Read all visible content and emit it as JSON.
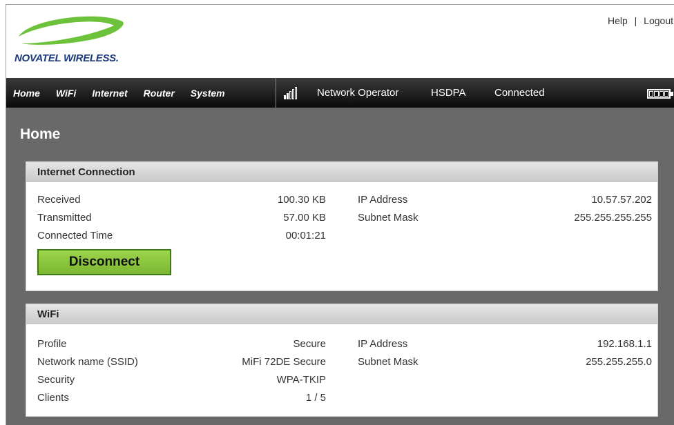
{
  "brand": {
    "name": "NOVATEL WIRELESS."
  },
  "top_links": {
    "help": "Help",
    "separator": "|",
    "logout": "Logout"
  },
  "nav": {
    "items": [
      "Home",
      "WiFi",
      "Internet",
      "Router",
      "System"
    ]
  },
  "status": {
    "signal_bars_filled": 2,
    "signal_bars_total": 5,
    "operator": "Network Operator",
    "technology": "HSDPA",
    "connection": "Connected",
    "battery_cells": 4
  },
  "page": {
    "title": "Home"
  },
  "internet_connection": {
    "title": "Internet Connection",
    "left": [
      {
        "label": "Received",
        "value": "100.30 KB"
      },
      {
        "label": "Transmitted",
        "value": "57.00 KB"
      },
      {
        "label": "Connected Time",
        "value": "00:01:21"
      }
    ],
    "right": [
      {
        "label": "IP Address",
        "value": "10.57.57.202"
      },
      {
        "label": "Subnet Mask",
        "value": "255.255.255.255"
      }
    ],
    "button_label": "Disconnect"
  },
  "wifi": {
    "title": "WiFi",
    "left": [
      {
        "label": "Profile",
        "value": "Secure"
      },
      {
        "label": "Network name (SSID)",
        "value": "MiFi 72DE Secure"
      },
      {
        "label": "Security",
        "value": "WPA-TKIP"
      },
      {
        "label": "Clients",
        "value": "1 / 5"
      }
    ],
    "right": [
      {
        "label": "IP Address",
        "value": "192.168.1.1"
      },
      {
        "label": "Subnet Mask",
        "value": "255.255.255.0"
      }
    ]
  },
  "colors": {
    "accent_green": "#8cc63f",
    "brand_blue": "#1c3a7a",
    "logo_green": "#6cc23a"
  }
}
